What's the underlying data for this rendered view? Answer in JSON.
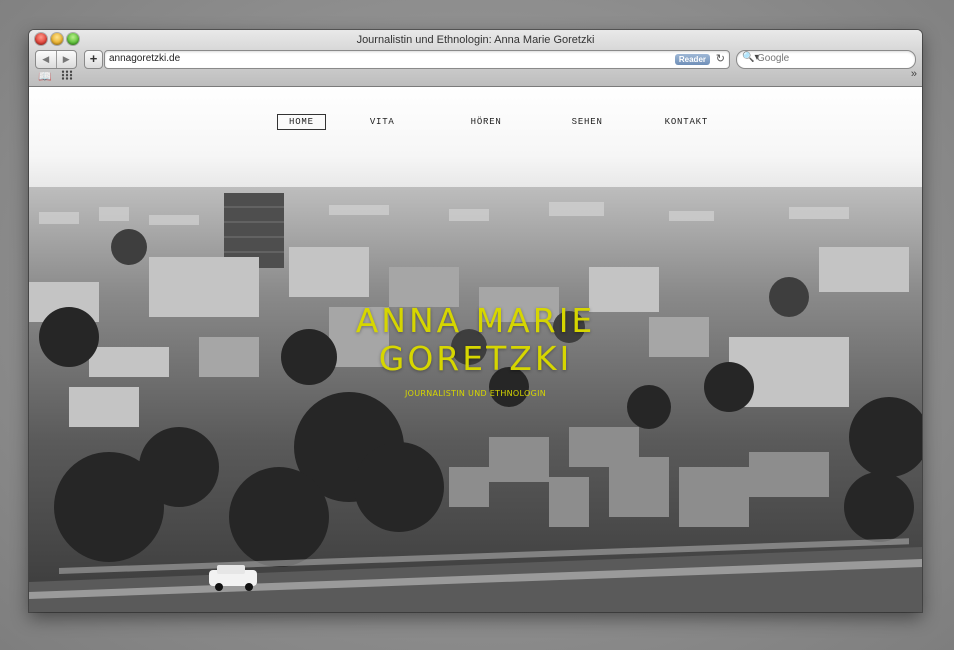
{
  "browser": {
    "window_title": "Journalistin und Ethnologin: Anna Marie Goretzki",
    "back_label": "◀",
    "forward_label": "▶",
    "add_label": "+",
    "url": "annagoretzki.de",
    "reader_label": "Reader",
    "reload_label": "↻",
    "search_placeholder": "Google",
    "search_icon_glyph": "🔍▾",
    "overflow_label": "»",
    "bookmarks_icon_glyph": "📖"
  },
  "site": {
    "nav": [
      {
        "label": "HOME",
        "active": true
      },
      {
        "label": "VITA",
        "active": false
      },
      {
        "label": "HÖREN",
        "active": false
      },
      {
        "label": "SEHEN",
        "active": false
      },
      {
        "label": "KONTAKT",
        "active": false
      }
    ],
    "title_line1": "ANNA MARIE",
    "title_line2": "GORETZKI",
    "subtitle": "JOURNALISTIN UND ETHNOLOGIN"
  },
  "colors": {
    "accent_title": "#d6d600",
    "desktop_bg": "#8d8d8d"
  }
}
